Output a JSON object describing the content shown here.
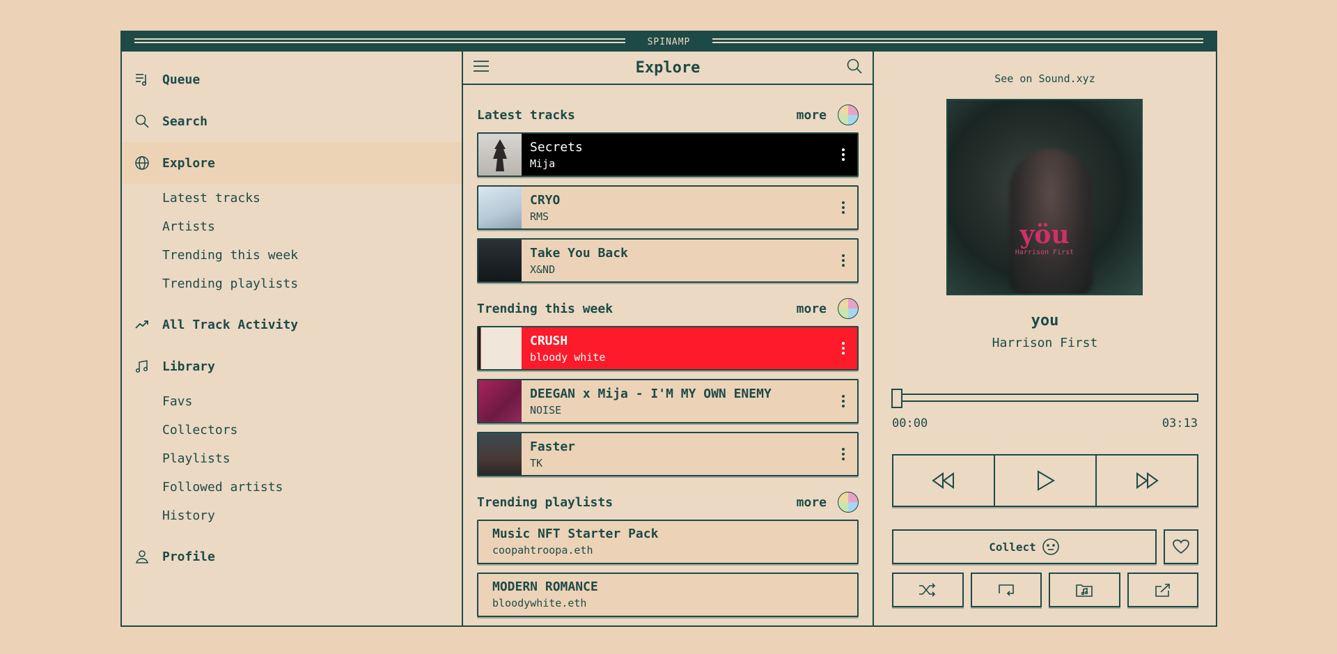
{
  "app": {
    "title": "SPINAMP"
  },
  "sidebar": {
    "items": [
      {
        "label": "Queue",
        "icon": "queue-icon"
      },
      {
        "label": "Search",
        "icon": "search-icon"
      },
      {
        "label": "Explore",
        "icon": "globe-icon",
        "active": true
      },
      {
        "label": "All Track Activity",
        "icon": "trending-icon"
      },
      {
        "label": "Library",
        "icon": "music-note-icon"
      },
      {
        "label": "Profile",
        "icon": "user-icon"
      }
    ],
    "explore_sub": [
      "Latest tracks",
      "Artists",
      "Trending this week",
      "Trending playlists"
    ],
    "library_sub": [
      "Favs",
      "Collectors",
      "Playlists",
      "Followed artists",
      "History"
    ]
  },
  "explore": {
    "title": "Explore",
    "more_label": "more",
    "sections": {
      "latest": {
        "title": "Latest tracks",
        "tracks": [
          {
            "title": "Secrets",
            "artist": "Mija",
            "bg": "#000000"
          },
          {
            "title": "CRYO",
            "artist": "RMS",
            "bg": "#ecd3b7"
          },
          {
            "title": "Take You Back",
            "artist": "X&ND",
            "bg": "#ecd3b7"
          }
        ]
      },
      "trending": {
        "title": "Trending this week",
        "tracks": [
          {
            "title": "CRUSH",
            "artist": "bloody white",
            "bg": "#fd1a2a"
          },
          {
            "title": "DEEGAN x Mija - I'M MY OWN ENEMY",
            "artist": "NOISE",
            "bg": "#ecd3b7"
          },
          {
            "title": "Faster",
            "artist": "TK",
            "bg": "#ecd3b7"
          }
        ]
      },
      "playlists": {
        "title": "Trending playlists",
        "items": [
          {
            "title": "Music NFT Starter Pack",
            "owner": "coopahtroopa.eth"
          },
          {
            "title": "MODERN ROMANCE",
            "owner": "bloodywhite.eth"
          }
        ]
      }
    }
  },
  "player": {
    "see_on": "See on Sound.xyz",
    "cover_text": "yöu",
    "cover_subtext": "Harrison First",
    "song": "you",
    "artist": "Harrison First",
    "time_current": "00:00",
    "time_total": "03:13",
    "progress": 0,
    "collect_label": "Collect"
  },
  "colors": {
    "background": "#ecd3b7",
    "window": "#ebd9c3",
    "primary": "#1d4a47",
    "active_track": "#fd1a2a"
  }
}
